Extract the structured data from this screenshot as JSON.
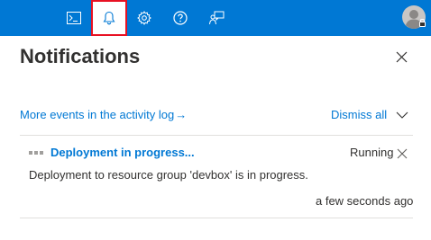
{
  "topbar": {
    "icons": [
      "cloud-shell-icon",
      "notifications-bell-icon",
      "settings-gear-icon",
      "help-question-icon",
      "feedback-icon"
    ],
    "accent_color": "#0078d4",
    "active_highlight_color": "#e81123"
  },
  "panel": {
    "title": "Notifications",
    "activity_log_link": "More events in the activity log",
    "activity_log_arrow": "→",
    "dismiss_all_label": "Dismiss all"
  },
  "notification": {
    "title": "Deployment in progress...",
    "status": "Running",
    "description": "Deployment to resource group 'devbox' is in progress.",
    "time": "a few seconds ago"
  }
}
